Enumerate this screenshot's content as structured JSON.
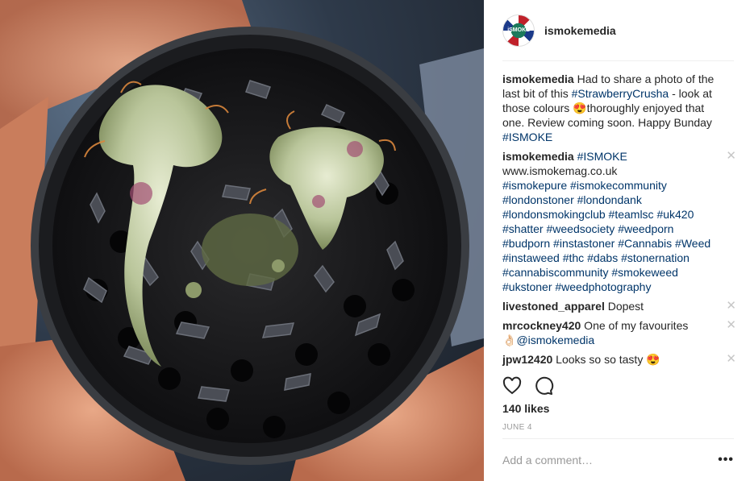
{
  "post": {
    "avatar_text": "iSMOKE",
    "username": "ismokemedia",
    "caption": {
      "user": "ismokemedia",
      "text_1": " Had to share a photo of the last bit of this ",
      "tag_1": "#StrawberryCrusha",
      "text_2": " - look at those colours ",
      "emoji": "😍",
      "text_3": "thoroughly enjoyed that one. Review coming soon. Happy Bunday ",
      "tag_2": "#ISMOKE"
    },
    "comments": [
      {
        "user": "ismokemedia",
        "tag_first": "#ISMOKE",
        "line_url": "www.ismokemag.co.uk",
        "tags": "#ismokepure #ismokecommunity #londonstoner #londondank #londonsmokingclub #teamlsc #uk420 #shatter #weedsociety #weedporn #budporn #instastoner #Cannabis #Weed #instaweed #thc #dabs #stonernation #cannabiscommunity #smokeweed #ukstoner #weedphotography",
        "close": "✕"
      },
      {
        "user": "livestoned_apparel",
        "text": " Dopest",
        "close": "✕"
      },
      {
        "user": "mrcockney420",
        "text": " One of my favourites ",
        "emoji": "👌🏻",
        "mention": "@ismokemedia",
        "close": "✕"
      },
      {
        "user": "jpw12420",
        "text": " Looks so so tasty ",
        "emoji": "😍",
        "close": "✕"
      }
    ],
    "likes": "140 likes",
    "date": "JUNE 4",
    "add_comment_placeholder": "Add a comment…",
    "more": "•••"
  },
  "icons": [
    "heart-icon",
    "comment-icon",
    "more-options-icon",
    "close-icon"
  ]
}
